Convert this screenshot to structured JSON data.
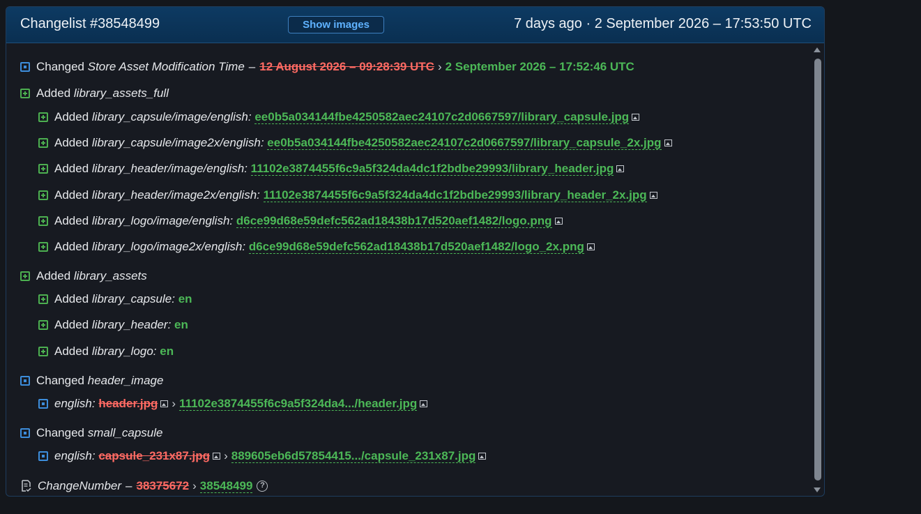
{
  "header": {
    "title": "Changelist #38548499",
    "show_images_label": "Show images",
    "time": "7 days ago · 2 September 2026 – 17:53:50 UTC"
  },
  "rows": {
    "r0": {
      "action": "Changed",
      "key": "Store Asset Modification Time",
      "old": "12 August 2026 – 09:28:39 UTC",
      "new": "2 September 2026 – 17:52:46 UTC"
    },
    "r1": {
      "action": "Added",
      "key": "library_assets_full"
    },
    "r2": {
      "action": "Added",
      "key": "library_capsule/image/english:",
      "new": "ee0b5a034144fbe4250582aec24107c2d0667597/library_capsule.jpg"
    },
    "r3": {
      "action": "Added",
      "key": "library_capsule/image2x/english:",
      "new": "ee0b5a034144fbe4250582aec24107c2d0667597/library_capsule_2x.jpg"
    },
    "r4": {
      "action": "Added",
      "key": "library_header/image/english:",
      "new": "11102e3874455f6c9a5f324da4dc1f2bdbe29993/library_header.jpg"
    },
    "r5": {
      "action": "Added",
      "key": "library_header/image2x/english:",
      "new": "11102e3874455f6c9a5f324da4dc1f2bdbe29993/library_header_2x.jpg"
    },
    "r6": {
      "action": "Added",
      "key": "library_logo/image/english:",
      "new": "d6ce99d68e59defc562ad18438b17d520aef1482/logo.png"
    },
    "r7": {
      "action": "Added",
      "key": "library_logo/image2x/english:",
      "new": "d6ce99d68e59defc562ad18438b17d520aef1482/logo_2x.png"
    },
    "r8": {
      "action": "Added",
      "key": "library_assets"
    },
    "r9": {
      "action": "Added",
      "key": "library_capsule:",
      "new": "en"
    },
    "r10": {
      "action": "Added",
      "key": "library_header:",
      "new": "en"
    },
    "r11": {
      "action": "Added",
      "key": "library_logo:",
      "new": "en"
    },
    "r12": {
      "action": "Changed",
      "key": "header_image"
    },
    "r13": {
      "key": "english:",
      "old": "header.jpg",
      "new": "11102e3874455f6c9a5f324da4.../header.jpg"
    },
    "r14": {
      "action": "Changed",
      "key": "small_capsule"
    },
    "r15": {
      "key": "english:",
      "old": "capsule_231x87.jpg",
      "new": "889605eb6d57854415.../capsule_231x87.jpg"
    },
    "r16": {
      "key": "ChangeNumber",
      "old": "38375672",
      "new": "38548499",
      "help": "?"
    }
  },
  "separators": {
    "dash": "–",
    "arrow": "›"
  },
  "icons": {
    "added": "plus-square-icon",
    "changed": "dot-square-icon",
    "image": "image-icon",
    "doc": "document-check-icon",
    "help": "question-circle-icon"
  },
  "colors": {
    "added": "#4cb857",
    "removed": "#ff6a63",
    "changed": "#3d8ddb",
    "accent": "#5fb2ff",
    "header_bg": "#0a2f51"
  }
}
